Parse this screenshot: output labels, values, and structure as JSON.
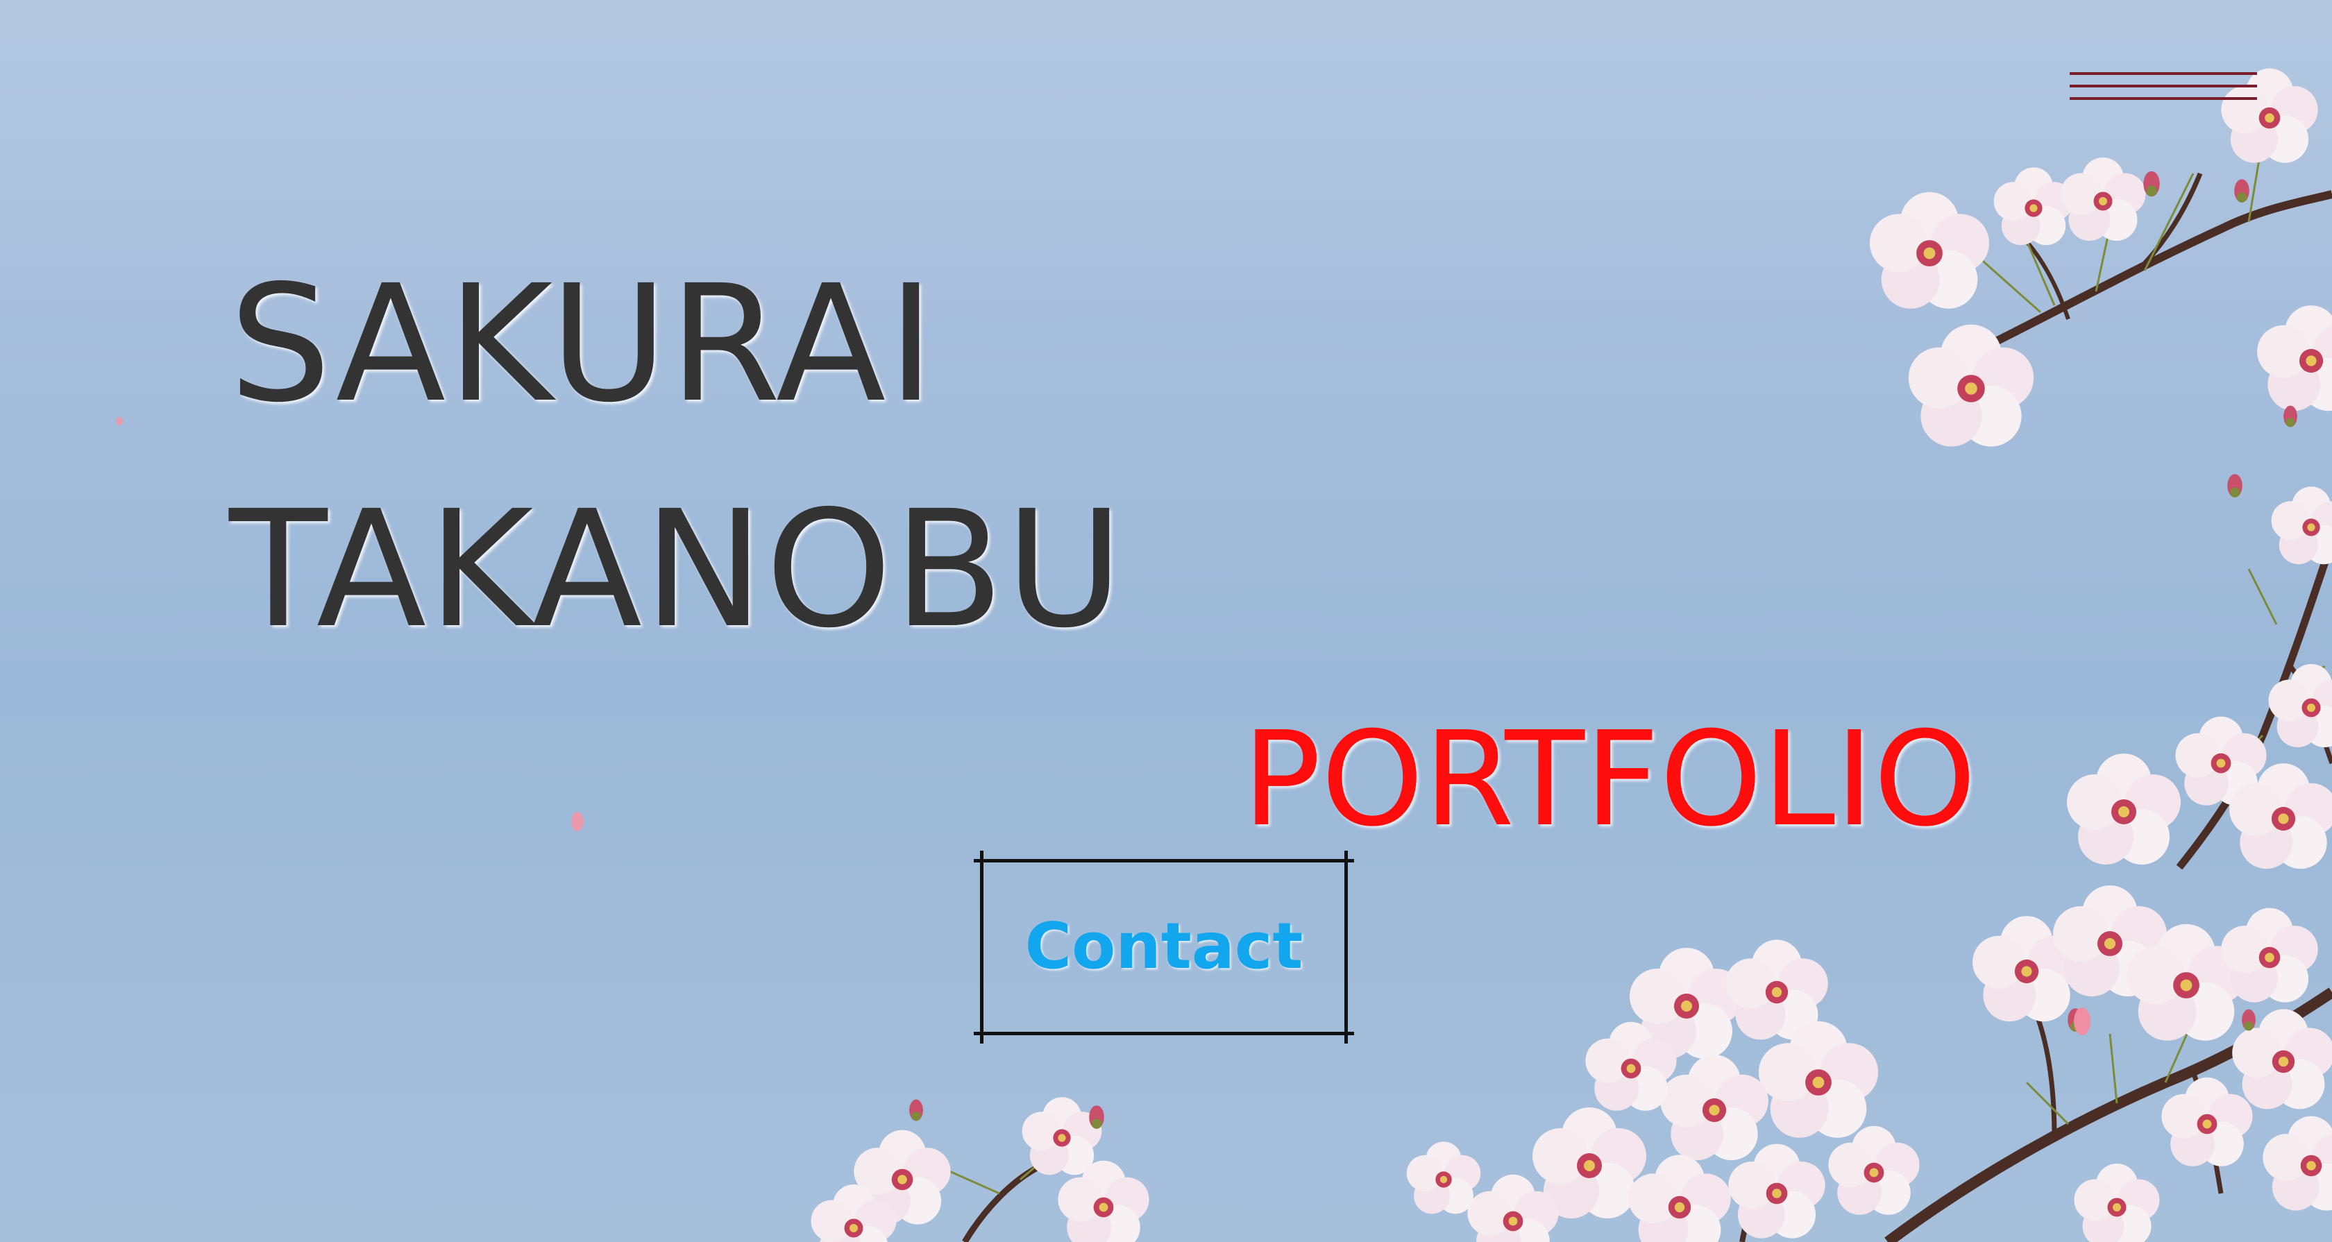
{
  "hero": {
    "name_line1": "SAKURAI",
    "name_line2": "TAKANOBU",
    "subtitle": "PORTFOLIO",
    "contact_label": "Contact"
  },
  "menu": {
    "icon": "hamburger-menu-icon"
  },
  "colors": {
    "sky": "#a7bfdd",
    "name_text": "#333333",
    "subtitle_text": "#ff0d0d",
    "contact_text": "#12a6ee",
    "menu_bars": "#7a1f2a",
    "blossom": "#f6eef1",
    "blossom_center": "#c2405a",
    "branch": "#4a2e26"
  }
}
